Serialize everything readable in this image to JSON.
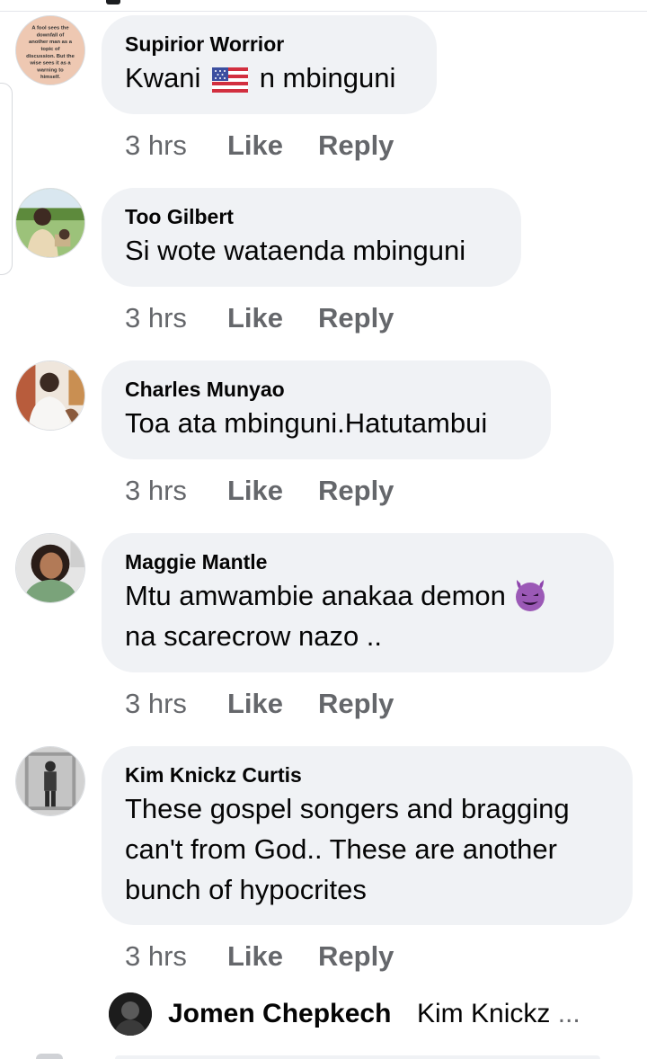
{
  "comments": [
    {
      "author": "Supirior Worrior",
      "text_parts": [
        "Kwani",
        "n mbinguni"
      ],
      "emoji": "us-flag-emoji",
      "avatar_text": "A fool sees the downfall of another man as a topic of discussion. But the wise sees it as a warning to himself.",
      "time": "3 hrs",
      "like": "Like",
      "reply": "Reply"
    },
    {
      "author": "Too Gilbert",
      "text": "Si wote wataenda mbinguni",
      "time": "3 hrs",
      "like": "Like",
      "reply": "Reply"
    },
    {
      "author": "Charles Munyao",
      "text": "Toa ata mbinguni.Hatutambui",
      "time": "3 hrs",
      "like": "Like",
      "reply": "Reply"
    },
    {
      "author": "Maggie Mantle",
      "text_line1": "Mtu amwambie anakaa demon",
      "emoji": "smiling-devil-emoji",
      "text_line2": "na scarecrow nazo ..",
      "time": "3 hrs",
      "like": "Like",
      "reply": "Reply"
    },
    {
      "author": "Kim Knickz Curtis",
      "lines": [
        "These gospel songers and bragging",
        "can't from God.. These are another",
        "bunch of hypocrites"
      ],
      "time": "3 hrs",
      "like": "Like",
      "reply": "Reply"
    }
  ],
  "reply_preview": {
    "author": "Jomen Chepkech",
    "text": "Kim Knickz",
    "more": "..."
  },
  "colors": {
    "bubble": "#f0f2f5",
    "meta": "#65676b",
    "text": "#050505"
  }
}
